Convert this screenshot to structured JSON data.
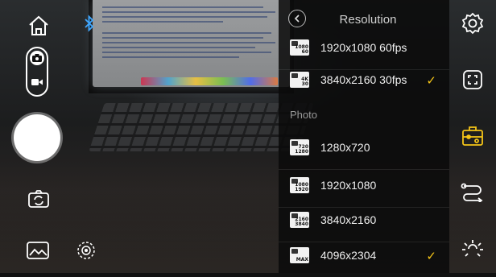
{
  "panel": {
    "title": "Resolution",
    "video_rows": [
      {
        "label": "1920x1080  60fps",
        "badge_top": "1080",
        "badge_bottom": "60",
        "selected": false
      },
      {
        "label": "3840x2160  30fps",
        "badge_top": "4K",
        "badge_bottom": "30",
        "selected": true
      }
    ],
    "section_label": "Photo",
    "photo_rows": [
      {
        "label": "1280x720",
        "badge_top": "720",
        "badge_bottom": "1280",
        "selected": false
      },
      {
        "label": "1920x1080",
        "badge_top": "1080",
        "badge_bottom": "1920",
        "selected": false
      },
      {
        "label": "3840x2160",
        "badge_top": "2160",
        "badge_bottom": "3840",
        "selected": false
      },
      {
        "label": "4096x2304",
        "badge_top": "",
        "badge_bottom": "MAX",
        "selected": true
      }
    ],
    "checkmark": "✓"
  },
  "left_controls": {
    "home_icon": "home-icon",
    "bluetooth_icon": "bluetooth-icon",
    "mode_toggle": [
      "photo-mode",
      "video-mode"
    ],
    "active_mode": "photo",
    "switch_camera_icon": "switch-camera-icon",
    "gallery_icon": "gallery-icon",
    "focus_icon": "focus-target-icon"
  },
  "right_controls": [
    "settings-gear-icon",
    "fullscreen-icon",
    "gimbal-control-icon",
    "follow-mode-icon",
    "brightness-icon"
  ],
  "colors": {
    "accent": "#f5c518",
    "bluetooth": "#3fa7ff",
    "panel_bg": "#0a0a0a"
  }
}
